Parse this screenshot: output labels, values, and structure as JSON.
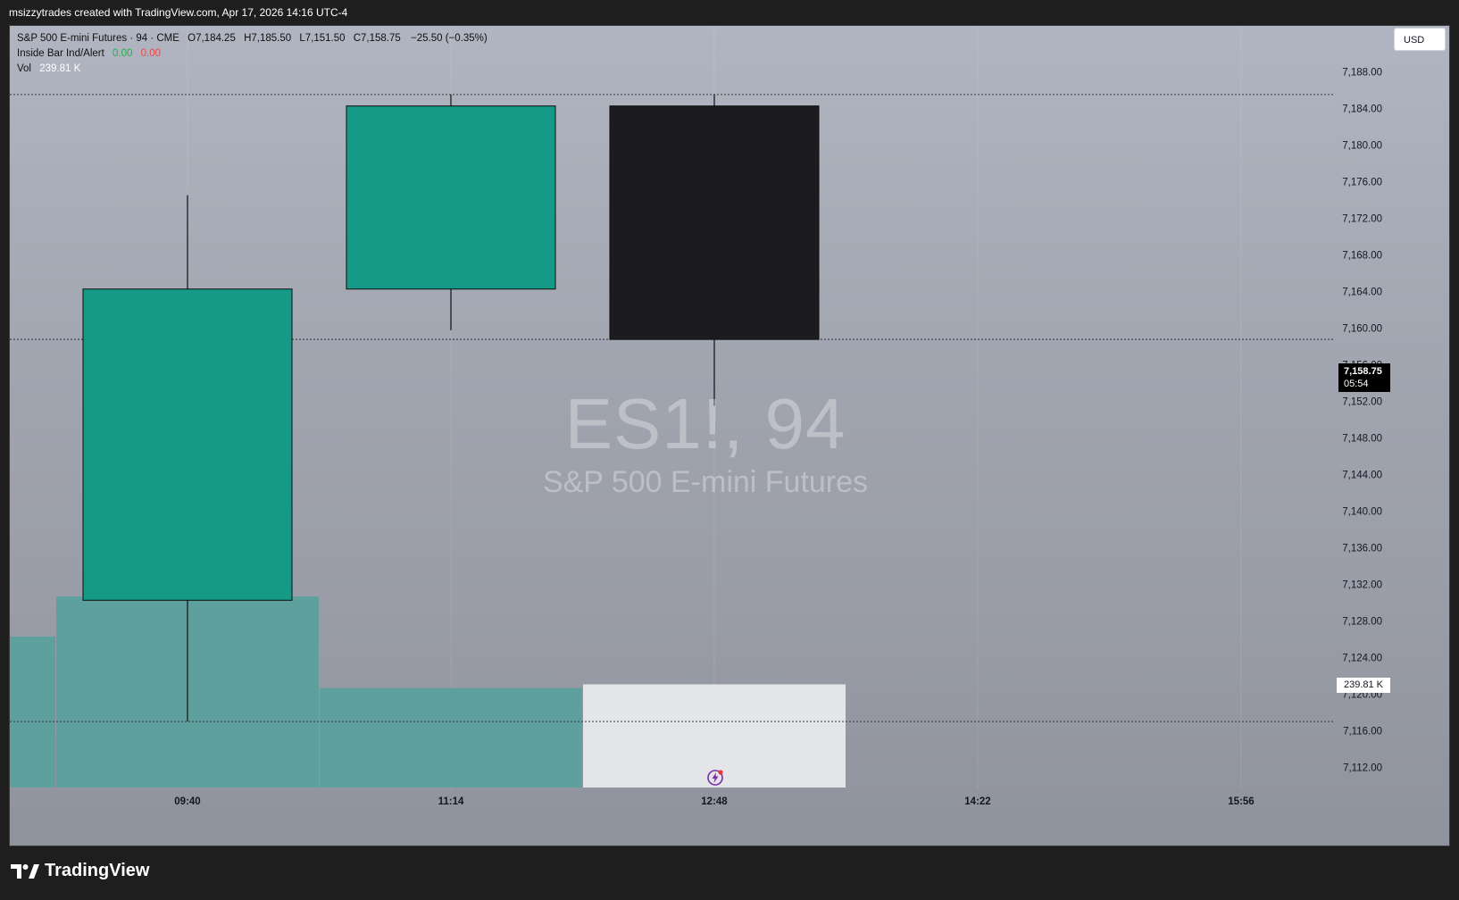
{
  "header": {
    "attribution": "msizzytrades created with TradingView.com, Apr 17, 2026 14:16 UTC-4"
  },
  "legend": {
    "symbol_line": "S&P 500 E-mini Futures · 94 · CME",
    "open": "O7,184.25",
    "high": "H7,185.50",
    "low": "L7,151.50",
    "close": "C7,158.75",
    "change": "−25.50 (−0.35%)",
    "indicator_name": "Inside Bar Ind/Alert",
    "indicator_val1": "0.00",
    "indicator_val2": "0.00",
    "vol_label": "Vol",
    "vol_value": "239.81 K"
  },
  "currency_button": "USD",
  "watermark": {
    "symbol": "ES1!, 94",
    "name": "S&P 500 E-mini Futures"
  },
  "last_price": {
    "price": "7,158.75",
    "countdown": "05:54"
  },
  "volume_badge": "239.81 K",
  "footer": {
    "brand": "TradingView"
  },
  "colors": {
    "up": "#159a87",
    "down": "#1c1c1e",
    "volume_up": "#5ea09e",
    "volume_last": "#e4e5e9"
  },
  "chart_data": {
    "type": "candlestick",
    "x_axis_labels": [
      "09:40",
      "11:14",
      "12:48",
      "14:22",
      "15:56"
    ],
    "y_ticks": [
      7188,
      7184,
      7180,
      7176,
      7172,
      7168,
      7164,
      7160,
      7156,
      7152,
      7148,
      7144,
      7140,
      7136,
      7132,
      7128,
      7124,
      7120,
      7116,
      7112
    ],
    "ylim": [
      7109.5,
      7193
    ],
    "candles": [
      {
        "time": "09:40",
        "open": 7130.25,
        "high": 7174.5,
        "low": 7117.0,
        "close": 7164.25
      },
      {
        "time": "11:14",
        "open": 7164.25,
        "high": 7185.5,
        "low": 7159.75,
        "close": 7184.25
      },
      {
        "time": "12:48",
        "open": 7184.25,
        "high": 7185.5,
        "low": 7151.5,
        "close": 7158.75
      }
    ],
    "volume_bars": [
      {
        "label": "previous",
        "rel": 0.79
      },
      {
        "label": "09:40",
        "rel": 1.0
      },
      {
        "label": "11:14",
        "rel": 0.52
      },
      {
        "label": "12:48",
        "rel": 0.54
      }
    ],
    "dotted_lines": [
      7185.5,
      7158.75,
      7117.0
    ]
  }
}
